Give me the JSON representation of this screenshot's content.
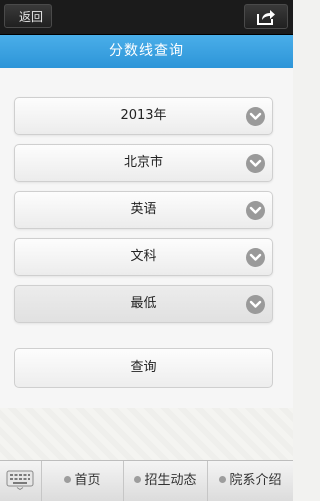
{
  "header": {
    "back_label": "返回",
    "share_icon": "share-icon"
  },
  "title": "分数线查询",
  "selects": [
    {
      "value": "2013年"
    },
    {
      "value": "北京市"
    },
    {
      "value": "英语"
    },
    {
      "value": "文科"
    },
    {
      "value": "最低"
    }
  ],
  "query_label": "查询",
  "tabs": [
    {
      "label": "首页"
    },
    {
      "label": "招生动态"
    },
    {
      "label": "院系介绍"
    }
  ],
  "colors": {
    "title_bar": "#2d95d8",
    "top_bar": "#1b1b1b"
  }
}
